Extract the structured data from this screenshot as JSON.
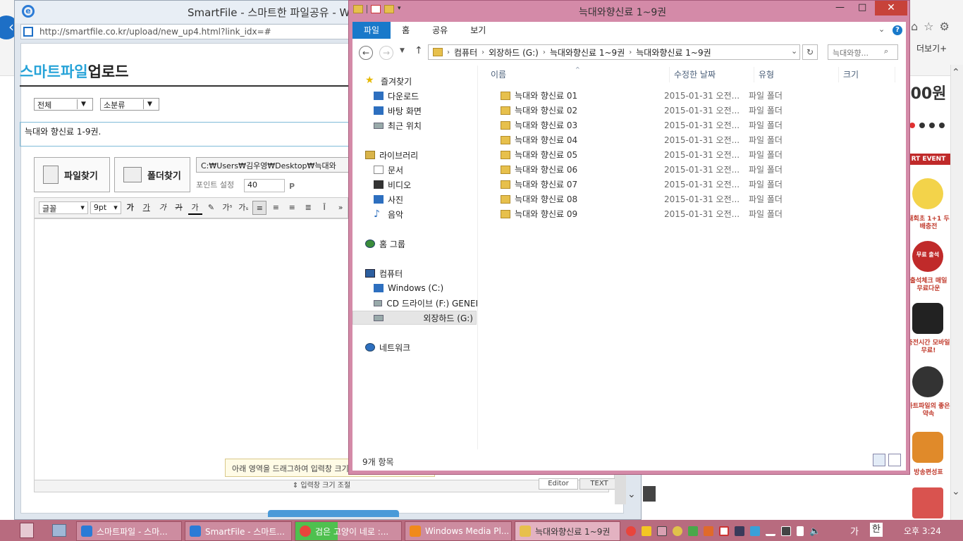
{
  "browser": {
    "favorites_label": "더보기",
    "ads": [
      {
        "text": "00원"
      },
      {
        "text": "RT EVENT"
      },
      {
        "text": "내회초 1+1 두배충전"
      },
      {
        "text": "출석체크 매일 무료다운"
      },
      {
        "text": "충전시간 모바일 무료!"
      },
      {
        "text": "마트파일의 좋은 약속"
      },
      {
        "text": "방송편성표"
      }
    ],
    "ad_badge_1": "무료 출석"
  },
  "popup": {
    "title": "SmartFile - 스마트한 파일공유 - W",
    "url": "http://smartfile.co.kr/upload/new_up4.html?link_idx=#",
    "brand_part1": "스마트파일",
    "brand_part2": "업로드",
    "category_select": "전체",
    "subcategory_select": "소분류",
    "title_value": "늑대와 향신료 1-9권.",
    "file_find_label": "파일찾기",
    "folder_find_label": "폴더찾기",
    "path_value": "C:₩Users₩김우영₩Desktop₩늑대와",
    "point_label": "포인트 설정",
    "point_value": "40",
    "point_unit": "P",
    "editor": {
      "font_select": "글꼴",
      "size_select": "9pt",
      "buttons": [
        "가",
        "가",
        "가",
        "가",
        "가"
      ],
      "sup": "가",
      "sub": "가",
      "more": "»"
    },
    "drag_tip": "아래 영역을 드래그하여 입력창 크기를",
    "resize_label": "⇕ 입력창 크기 조절",
    "tab_editor": "Editor",
    "tab_text": "TEXT"
  },
  "explorer": {
    "title": "늑대와향신료 1~9권",
    "ribbon_tabs": [
      "파일",
      "홈",
      "공유",
      "보기"
    ],
    "address": [
      "컴퓨터",
      "외장하드 (G:)",
      "늑대와향신료 1~9권",
      "늑대와향신료 1~9권"
    ],
    "search_placeholder": "늑대와향...",
    "nav": {
      "favorites": "즐겨찾기",
      "downloads": "다운로드",
      "desktop": "바탕 화면",
      "recent": "최근 위치",
      "libraries": "라이브러리",
      "documents": "문서",
      "videos": "비디오",
      "pictures": "사진",
      "music": "음악",
      "homegroup": "홈 그룹",
      "computer": "컴퓨터",
      "drive_c": "Windows (C:)",
      "drive_f": "CD 드라이브 (F:) GENEI",
      "drive_g": "외장하드 (G:)",
      "network": "네트워크"
    },
    "columns": {
      "name": "이름",
      "modified": "수정한 날짜",
      "type": "유형",
      "size": "크기"
    },
    "files": [
      {
        "name": "늑대와 향신료 01",
        "modified": "2015-01-31 오전...",
        "type": "파일 폴더"
      },
      {
        "name": "늑대와 향신료 02",
        "modified": "2015-01-31 오전...",
        "type": "파일 폴더"
      },
      {
        "name": "늑대와 향신료 03",
        "modified": "2015-01-31 오전...",
        "type": "파일 폴더"
      },
      {
        "name": "늑대와 향신료 04",
        "modified": "2015-01-31 오전...",
        "type": "파일 폴더"
      },
      {
        "name": "늑대와 향신료 05",
        "modified": "2015-01-31 오전...",
        "type": "파일 폴더"
      },
      {
        "name": "늑대와 향신료 06",
        "modified": "2015-01-31 오전...",
        "type": "파일 폴더"
      },
      {
        "name": "늑대와 향신료 07",
        "modified": "2015-01-31 오전...",
        "type": "파일 폴더"
      },
      {
        "name": "늑대와 향신료 08",
        "modified": "2015-01-31 오전...",
        "type": "파일 폴더"
      },
      {
        "name": "늑대와 향신료 09",
        "modified": "2015-01-31 오전...",
        "type": "파일 폴더"
      }
    ],
    "status": "9개 항목"
  },
  "taskbar": {
    "items": [
      {
        "label": "스마트파일 - 스마...",
        "icon": "ie-icon"
      },
      {
        "label": "SmartFile - 스마트...",
        "icon": "ie-icon"
      },
      {
        "label": "검은 고양이 네로 :...",
        "icon": "chrome-icon"
      },
      {
        "label": "Windows Media Pl...",
        "icon": "media-player-icon"
      },
      {
        "label": "늑대와향신료 1~9권",
        "icon": "folder-icon"
      }
    ],
    "ime_mode": "가",
    "ime_lang": "한",
    "clock": "오후 3:24"
  },
  "colors": {
    "explorer_frame": "#d48aa8",
    "ribbon_file_tab": "#1979ca",
    "taskbar": "#b86b7f",
    "close_button": "#c7423a",
    "brand_accent": "#27a3d8"
  }
}
